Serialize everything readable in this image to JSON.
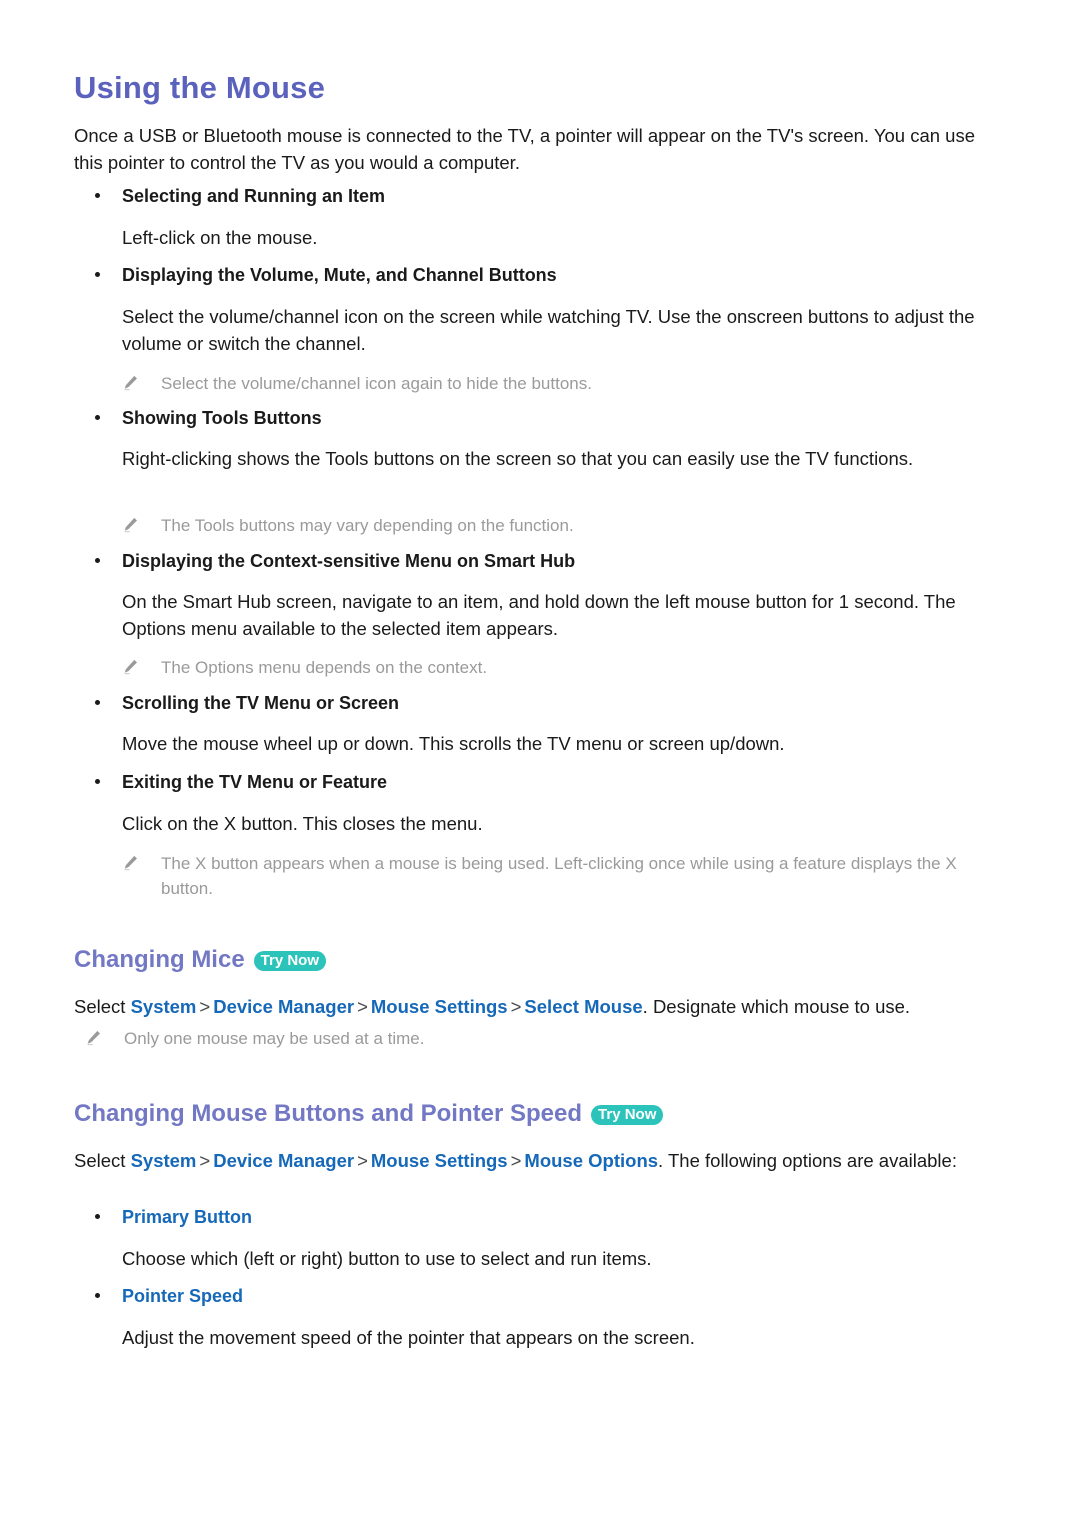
{
  "document": {
    "title": "Using the Mouse",
    "intro": "Once a USB or Bluetooth mouse is connected to the TV, a pointer will appear on the TV's screen. You can use this pointer to control the TV as you would a computer."
  },
  "mouse_features": [
    {
      "label": "Selecting and Running an Item",
      "body": "Left-click on the mouse.",
      "note": null
    },
    {
      "label": "Displaying the Volume, Mute, and Channel Buttons",
      "body": "Select the volume/channel icon on the screen while watching TV. Use the onscreen buttons to adjust the volume or switch the channel.",
      "note": "Select the volume/channel icon again to hide the buttons."
    },
    {
      "label": "Showing Tools Buttons",
      "body": "Right-clicking shows the Tools buttons on the screen so that you can easily use the TV functions.",
      "note": "The Tools buttons may vary depending on the function."
    },
    {
      "label": "Displaying the Context-sensitive Menu on Smart Hub",
      "body": "On the Smart Hub screen, navigate to an item, and hold down the left mouse button for 1 second. The Options menu available to the selected item appears.",
      "note": "The Options menu depends on the context."
    },
    {
      "label": "Scrolling the TV Menu or Screen",
      "body": "Move the mouse wheel up or down. This scrolls the TV menu or screen up/down.",
      "note": null
    },
    {
      "label": "Exiting the TV Menu or Feature",
      "body": "Click on the X button. This closes the menu.",
      "note": "The X button appears when a mouse is being used. Left-clicking once while using a feature displays the X button."
    }
  ],
  "changing_mice": {
    "heading": "Changing Mice",
    "badge": "Try Now",
    "path_prefix": "Select",
    "path": [
      "System",
      "Device Manager",
      "Mouse Settings",
      "Select Mouse"
    ],
    "separator": ">",
    "path_suffix": ". Designate which mouse to use.",
    "note": "Only one mouse may be used at a time."
  },
  "mouse_options": {
    "heading": "Changing Mouse Buttons and Pointer Speed",
    "badge": "Try Now",
    "path_prefix": "Select",
    "path": [
      "System",
      "Device Manager",
      "Mouse Settings",
      "Mouse Options"
    ],
    "separator": ">",
    "path_suffix": ". The following options are available:",
    "items": [
      {
        "label": "Primary Button",
        "body": "Choose which (left or right) button to use to select and run items."
      },
      {
        "label": "Pointer Speed",
        "body": "Adjust the movement speed of the pointer that appears on the screen."
      }
    ]
  },
  "colors": {
    "title": "#5B62BD",
    "section_heading": "#7278C4",
    "link": "#1668B8",
    "badge_bg": "#2CC3BB",
    "note_text": "#9A9A9A",
    "body_text": "#1A1A1A"
  },
  "icons": {
    "note": "pencil-icon",
    "bullet": "bullet-dot-icon"
  }
}
